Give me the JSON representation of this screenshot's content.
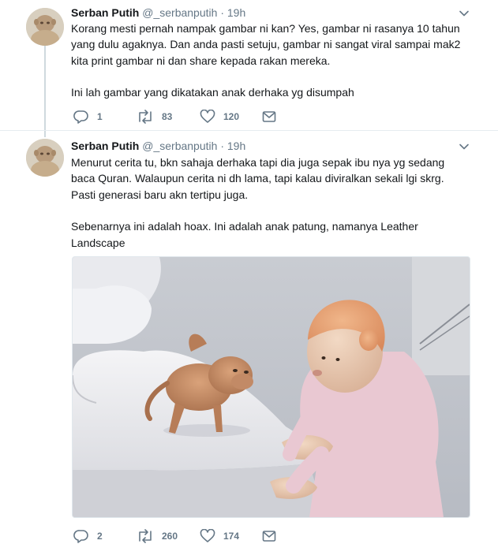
{
  "tweets": [
    {
      "author_name": "Serban Putih",
      "handle": "@_serbanputih",
      "separator": "·",
      "time": "19h",
      "paragraphs": [
        "Korang mesti pernah nampak gambar ni kan? Yes, gambar ni rasanya 10 tahun yang dulu agaknya. Dan anda pasti setuju, gambar ni sangat viral sampai mak2 kita print gambar ni dan share kepada rakan mereka.",
        "Ini lah gambar yang dikatakan anak derhaka yg disumpah"
      ],
      "actions": {
        "reply_count": "1",
        "retweet_count": "83",
        "like_count": "120"
      },
      "icons": [
        "reply-icon",
        "retweet-icon",
        "like-icon",
        "direct-message-icon",
        "chevron-down-icon"
      ]
    },
    {
      "author_name": "Serban Putih",
      "handle": "@_serbanputih",
      "separator": "·",
      "time": "19h",
      "paragraphs": [
        "Menurut cerita tu, bkn sahaja derhaka tapi dia juga sepak ibu nya yg sedang baca Quran. Walaupun cerita ni dh lama, tapi kalau diviralkan sekali lgi skrg. Pasti generasi baru akn tertipu juga.",
        "Sebenarnya ini adalah hoax. Ini adalah anak patung, namanya Leather Landscape"
      ],
      "actions": {
        "reply_count": "2",
        "retweet_count": "260",
        "like_count": "174"
      },
      "icons": [
        "reply-icon",
        "retweet-icon",
        "like-icon",
        "direct-message-icon",
        "chevron-down-icon"
      ]
    }
  ],
  "colors": {
    "text_primary": "#14171a",
    "text_secondary": "#657786",
    "thread_line": "#cfd9de",
    "divider": "#e6ecf0"
  }
}
